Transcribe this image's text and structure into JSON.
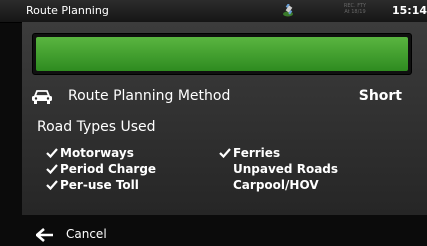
{
  "window": {
    "title": "Route Planning",
    "clock": "15:14",
    "status_text": "REC. FTY\nAt 18/19"
  },
  "progress": {
    "fraction": 1.0,
    "color": "#3fa12f"
  },
  "route_planning_method": {
    "icon": "car-icon",
    "label": "Route Planning Method",
    "value": "Short"
  },
  "road_types": {
    "header": "Road Types Used",
    "items": [
      {
        "label": "Motorways",
        "checked": true
      },
      {
        "label": "Period Charge",
        "checked": true
      },
      {
        "label": "Per-use Toll",
        "checked": true
      },
      {
        "label": "Ferries",
        "checked": true
      },
      {
        "label": "Unpaved Roads",
        "checked": false
      },
      {
        "label": "Carpool/HOV",
        "checked": false
      }
    ]
  },
  "footer": {
    "cancel_label": "Cancel",
    "cancel_icon": "arrow-left-icon"
  }
}
